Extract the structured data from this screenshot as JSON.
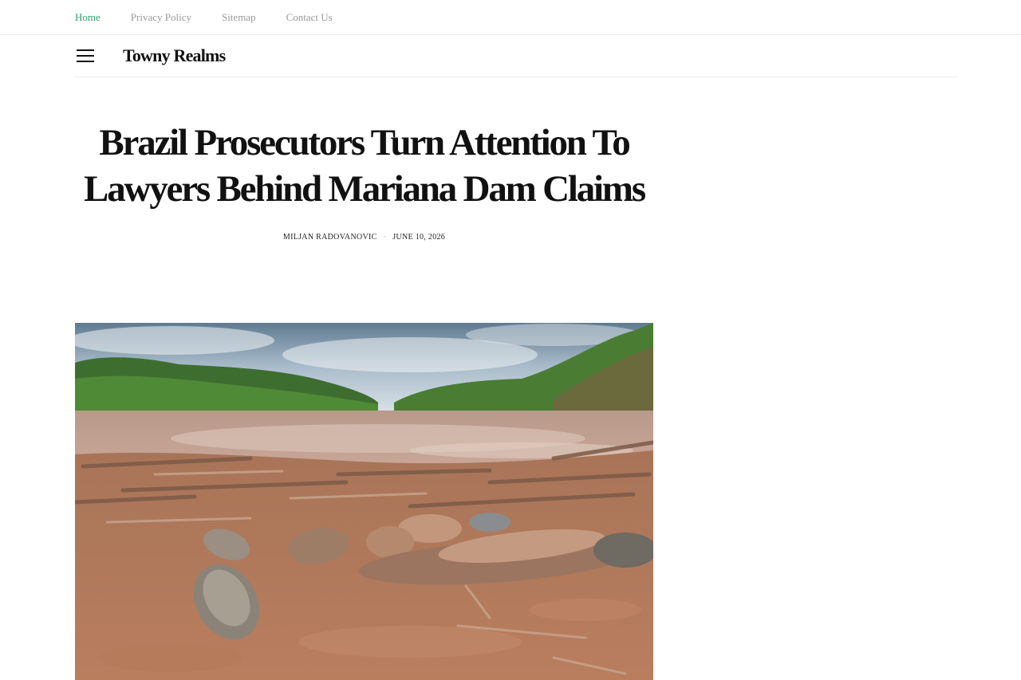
{
  "top_nav": {
    "items": [
      {
        "label": "Home",
        "active": true
      },
      {
        "label": "Privacy Policy",
        "active": false
      },
      {
        "label": "Sitemap",
        "active": false
      },
      {
        "label": "Contact Us",
        "active": false
      }
    ]
  },
  "header": {
    "menu_icon": "hamburger-menu-icon",
    "site_title": "Towny Realms"
  },
  "article": {
    "title": "Brazil Prosecutors Turn Attention To Lawyers Behind Mariana Dam Claims",
    "author": "MILJAN RADOVANOVIC",
    "separator": "·",
    "date": "JUNE 10, 2026"
  },
  "featured_image": {
    "subject": "mud-covered riverbank with dead fish and debris"
  },
  "colors": {
    "accent": "#2e9e6a",
    "nav_text": "#9a9a9a",
    "text": "#111111"
  }
}
